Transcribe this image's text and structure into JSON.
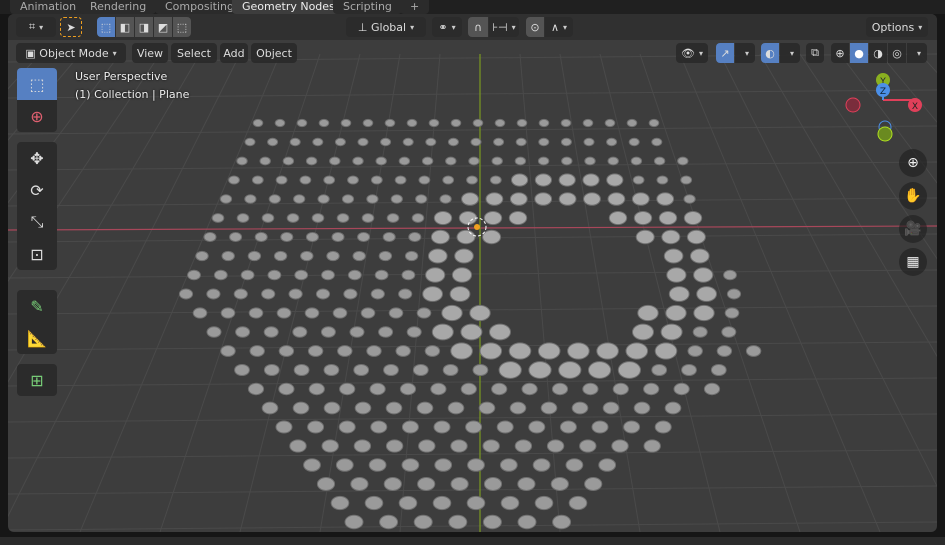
{
  "workspace_tabs": [
    {
      "label": "Animation"
    },
    {
      "label": "Rendering"
    },
    {
      "label": "Compositing"
    },
    {
      "label": "Geometry Nodes",
      "active": true
    },
    {
      "label": "Scripting"
    },
    {
      "label": "+"
    }
  ],
  "tool_header": {
    "transform_orientation": "Global",
    "options_label": "Options"
  },
  "view_header": {
    "mode": "Object Mode",
    "menus": [
      "View",
      "Select",
      "Add",
      "Object"
    ]
  },
  "viewport": {
    "perspective_label": "User Perspective",
    "collection_label": "(1) Collection | Plane"
  },
  "gizmo": {
    "x": "X",
    "y": "Y",
    "z": "Z",
    "colors": {
      "x": "#e0405a",
      "y": "#8ab020",
      "z": "#4b8fe8"
    }
  },
  "shading": {
    "active": "solid"
  },
  "accent_color": "#5680c2"
}
